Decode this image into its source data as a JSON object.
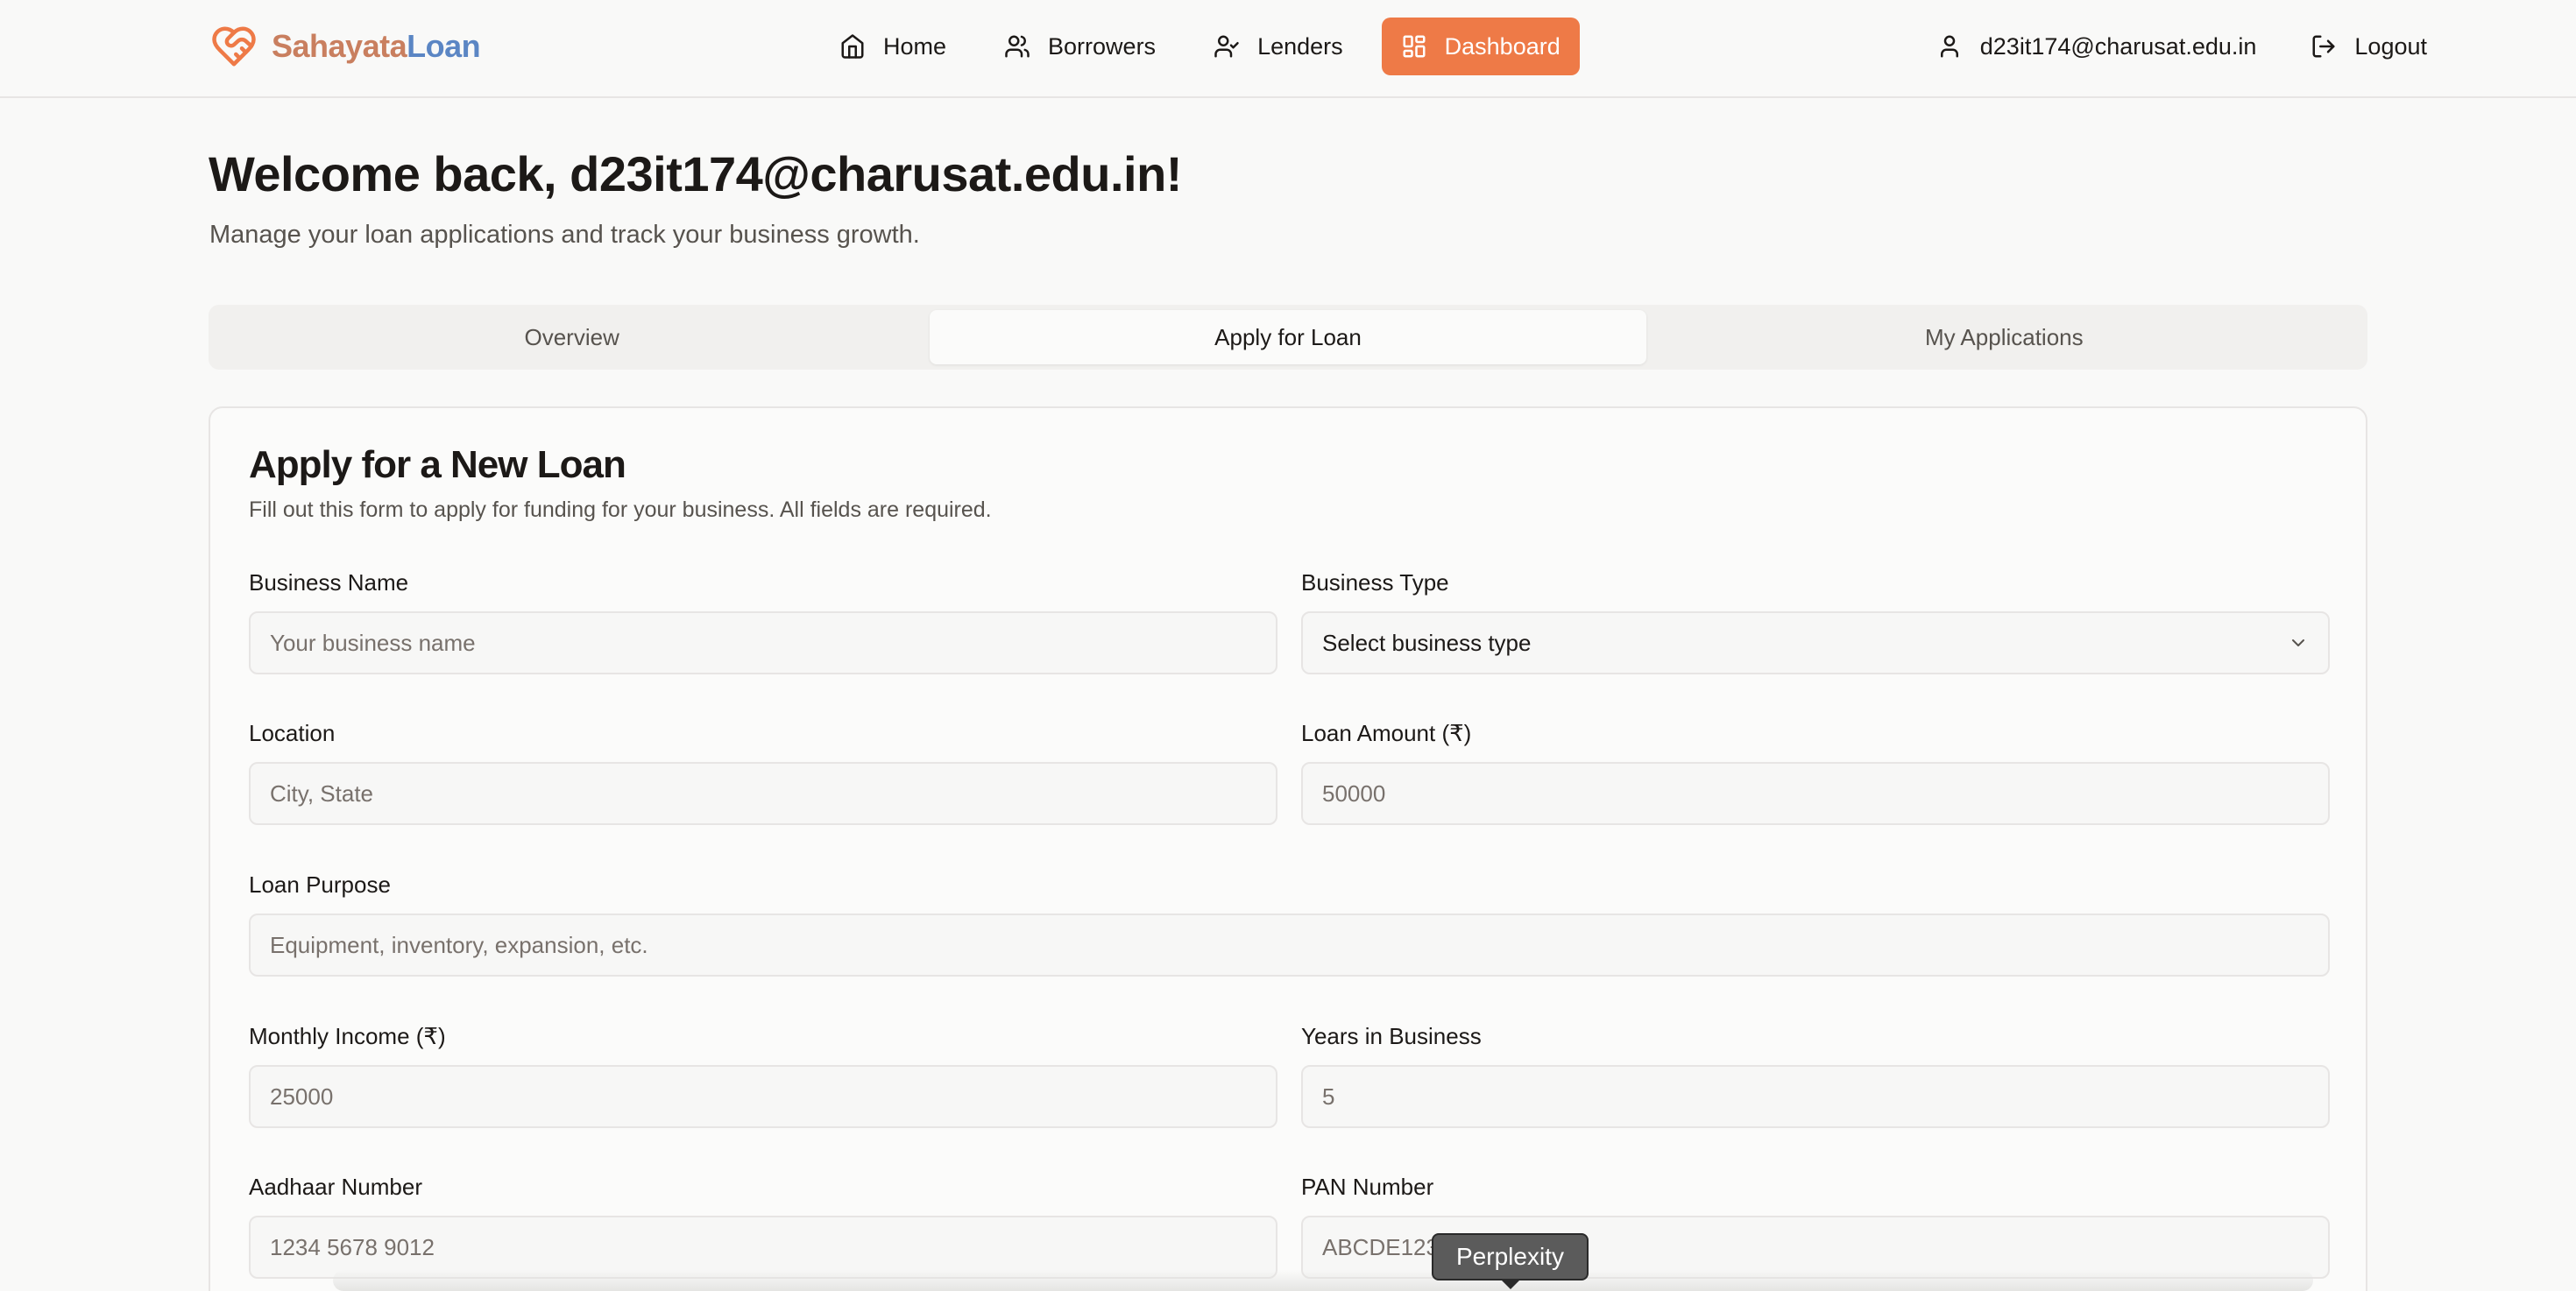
{
  "app": {
    "logo_part1": "Sahayata",
    "logo_part2": "Loan",
    "brand_color": "#ee7a47"
  },
  "nav": {
    "items": [
      {
        "label": "Home",
        "icon": "home-icon"
      },
      {
        "label": "Borrowers",
        "icon": "users-icon"
      },
      {
        "label": "Lenders",
        "icon": "user-check-icon"
      },
      {
        "label": "Dashboard",
        "icon": "dashboard-icon",
        "active": true
      }
    ]
  },
  "user": {
    "email": "d23it174@charusat.edu.in",
    "logout_label": "Logout"
  },
  "welcome": {
    "title": "Welcome back, d23it174@charusat.edu.in!",
    "subtitle": "Manage your loan applications and track your business growth."
  },
  "tabs": [
    {
      "label": "Overview"
    },
    {
      "label": "Apply for Loan",
      "active": true
    },
    {
      "label": "My Applications"
    }
  ],
  "form": {
    "title": "Apply for a New Loan",
    "subtitle": "Fill out this form to apply for funding for your business. All fields are required.",
    "business_name": {
      "label": "Business Name",
      "placeholder": "Your business name"
    },
    "business_type": {
      "label": "Business Type",
      "value": "Select business type"
    },
    "location": {
      "label": "Location",
      "placeholder": "City, State"
    },
    "loan_amount": {
      "label": "Loan Amount (₹)",
      "placeholder": "50000"
    },
    "loan_purpose": {
      "label": "Loan Purpose",
      "placeholder": "Equipment, inventory, expansion, etc."
    },
    "monthly_income": {
      "label": "Monthly Income (₹)",
      "placeholder": "25000"
    },
    "years_in_business": {
      "label": "Years in Business",
      "placeholder": "5"
    },
    "aadhaar": {
      "label": "Aadhaar Number",
      "placeholder": "1234 5678 9012"
    },
    "pan": {
      "label": "PAN Number",
      "placeholder": "ABCDE1234F"
    }
  },
  "tooltip": {
    "text": "Perplexity"
  }
}
